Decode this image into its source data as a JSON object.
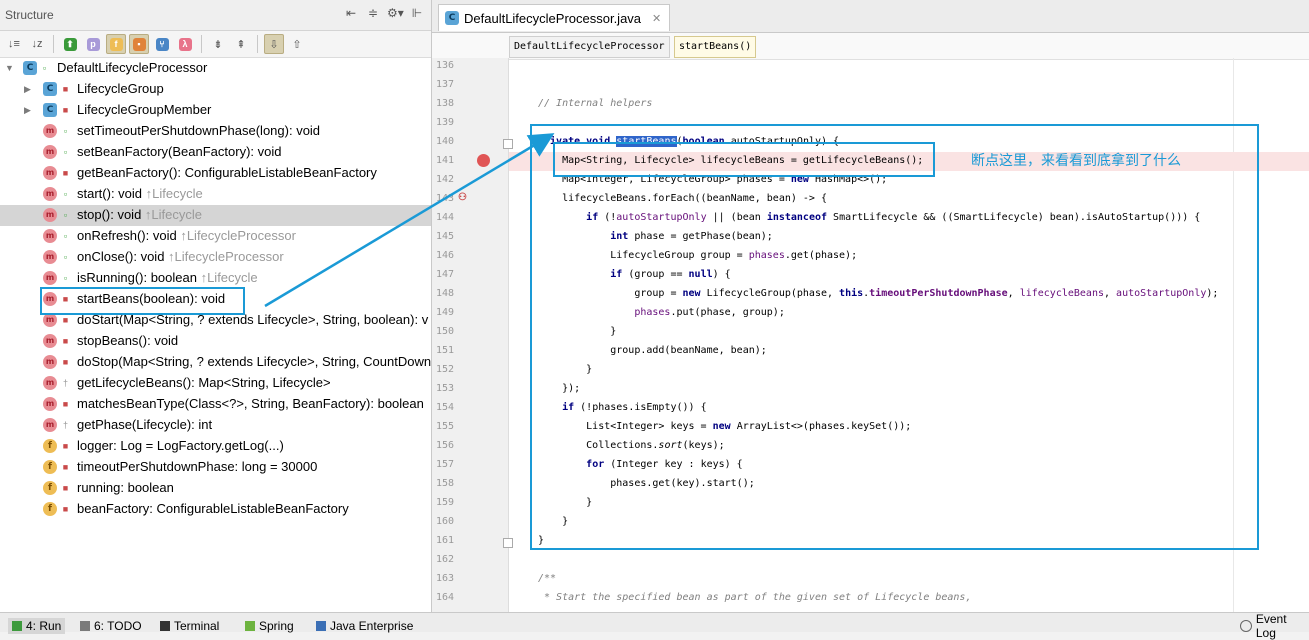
{
  "structure": {
    "title": "Structure",
    "header_tools": [
      "⇤",
      "≑",
      "⚙▾",
      "⊩"
    ],
    "toolbar_buttons": [
      {
        "name": "sort-by-visibility-icon",
        "glyph": "↓≡"
      },
      {
        "name": "sort-alpha-icon",
        "glyph": "↓z"
      },
      {
        "name": "show-inherited-icon",
        "glyph": "⬆"
      },
      {
        "name": "show-properties-icon",
        "glyph": "p"
      },
      {
        "name": "show-fields-icon",
        "glyph": "f"
      },
      {
        "name": "show-non-public-icon",
        "glyph": "▪"
      },
      {
        "name": "show-anonymous-icon",
        "glyph": "⑂"
      },
      {
        "name": "show-lambdas-icon",
        "glyph": "λ"
      },
      {
        "name": "expand-all-icon",
        "glyph": "⇟"
      },
      {
        "name": "collapse-all-icon",
        "glyph": "⇞"
      },
      {
        "name": "autoscroll-to-source-icon",
        "glyph": "⇩"
      },
      {
        "name": "autoscroll-from-source-icon",
        "glyph": "⇧"
      }
    ],
    "root": "DefaultLifecycleProcessor",
    "items": [
      {
        "icon": "c",
        "vis": "lock",
        "label": "LifecycleGroup",
        "inherited": "",
        "expandable": true
      },
      {
        "icon": "c",
        "vis": "lock",
        "label": "LifecycleGroupMember",
        "inherited": "",
        "expandable": true
      },
      {
        "icon": "m",
        "vis": "pub",
        "label": "setTimeoutPerShutdownPhase(long): void",
        "inherited": ""
      },
      {
        "icon": "m",
        "vis": "pub",
        "label": "setBeanFactory(BeanFactory): void",
        "inherited": ""
      },
      {
        "icon": "m",
        "vis": "lock",
        "label": "getBeanFactory(): ConfigurableListableBeanFactory",
        "inherited": ""
      },
      {
        "icon": "m",
        "vis": "pub",
        "label": "start(): void ",
        "inherited": "↑Lifecycle"
      },
      {
        "icon": "m",
        "vis": "pub",
        "label": "stop(): void ",
        "inherited": "↑Lifecycle",
        "selected": true
      },
      {
        "icon": "m",
        "vis": "pub",
        "label": "onRefresh(): void ",
        "inherited": "↑LifecycleProcessor"
      },
      {
        "icon": "m",
        "vis": "pub",
        "label": "onClose(): void ",
        "inherited": "↑LifecycleProcessor"
      },
      {
        "icon": "m",
        "vis": "pub",
        "label": "isRunning(): boolean ",
        "inherited": "↑Lifecycle"
      },
      {
        "icon": "m",
        "vis": "lock",
        "label": "startBeans(boolean): void",
        "inherited": ""
      },
      {
        "icon": "m",
        "vis": "lock",
        "label": "doStart(Map<String, ? extends Lifecycle>, String, boolean): v",
        "inherited": ""
      },
      {
        "icon": "m",
        "vis": "lock",
        "label": "stopBeans(): void",
        "inherited": ""
      },
      {
        "icon": "m",
        "vis": "lock",
        "label": "doStop(Map<String, ? extends Lifecycle>, String, CountDown",
        "inherited": ""
      },
      {
        "icon": "m",
        "vis": "pkg",
        "label": "getLifecycleBeans(): Map<String, Lifecycle>",
        "inherited": ""
      },
      {
        "icon": "m",
        "vis": "lock",
        "label": "matchesBeanType(Class<?>, String, BeanFactory): boolean",
        "inherited": ""
      },
      {
        "icon": "m",
        "vis": "pkg",
        "label": "getPhase(Lifecycle): int",
        "inherited": ""
      },
      {
        "icon": "f",
        "vis": "lock",
        "label": "logger: Log = LogFactory.getLog(...)",
        "inherited": ""
      },
      {
        "icon": "f",
        "vis": "lock",
        "label": "timeoutPerShutdownPhase: long = 30000",
        "inherited": ""
      },
      {
        "icon": "f",
        "vis": "lock",
        "label": "running: boolean",
        "inherited": ""
      },
      {
        "icon": "f",
        "vis": "lock",
        "label": "beanFactory: ConfigurableListableBeanFactory",
        "inherited": ""
      }
    ]
  },
  "editor": {
    "tab_label": "DefaultLifecycleProcessor.java",
    "breadcrumbs": [
      "DefaultLifecycleProcessor",
      "startBeans()"
    ],
    "annotation": "断点这里，来看看到底拿到了什么",
    "lines": [
      {
        "n": "136",
        "html": ""
      },
      {
        "n": "137",
        "html": ""
      },
      {
        "n": "138",
        "html": "<span class=\"cm\">// Internal helpers</span>"
      },
      {
        "n": "139",
        "html": ""
      },
      {
        "n": "140",
        "html": "<span class=\"kw\">private void</span> <span class=\"sel-word\">startBeans</span>(<span class=\"kw\">boolean</span> autoStartupOnly) {"
      },
      {
        "n": "141",
        "html": "    Map&lt;String, Lifecycle&gt; lifecycleBeans = getLifecycleBeans();"
      },
      {
        "n": "142",
        "html": "    Map&lt;Integer, LifecycleGroup&gt; phases = <span class=\"kw\">new</span> HashMap&lt;&gt;();"
      },
      {
        "n": "143",
        "html": "    lifecycleBeans.forEach((beanName, bean) -&gt; {"
      },
      {
        "n": "144",
        "html": "        <span class=\"kw\">if</span> (!<span class=\"fld\">autoStartupOnly</span> || (bean <span class=\"kw\">instanceof</span> SmartLifecycle &amp;&amp; ((SmartLifecycle) bean).isAutoStartup())) {"
      },
      {
        "n": "145",
        "html": "            <span class=\"kw\">int</span> phase = getPhase(bean);"
      },
      {
        "n": "146",
        "html": "            LifecycleGroup group = <span class=\"fld\">phases</span>.get(phase);"
      },
      {
        "n": "147",
        "html": "            <span class=\"kw\">if</span> (group == <span class=\"kw\">null</span>) {"
      },
      {
        "n": "148",
        "html": "                group = <span class=\"kw\">new</span> LifecycleGroup(phase, <span class=\"kw\">this</span>.<span class=\"fldb\">timeoutPerShutdownPhase</span>, <span class=\"fld\">lifecycleBeans</span>, <span class=\"fld\">autoStartupOnly</span>);"
      },
      {
        "n": "149",
        "html": "                <span class=\"fld\">phases</span>.put(phase, group);"
      },
      {
        "n": "150",
        "html": "            }"
      },
      {
        "n": "151",
        "html": "            group.add(beanName, bean);"
      },
      {
        "n": "152",
        "html": "        }"
      },
      {
        "n": "153",
        "html": "    });"
      },
      {
        "n": "154",
        "html": "    <span class=\"kw\">if</span> (!phases.isEmpty()) {"
      },
      {
        "n": "155",
        "html": "        List&lt;Integer&gt; keys = <span class=\"kw\">new</span> ArrayList&lt;&gt;(phases.keySet());"
      },
      {
        "n": "156",
        "html": "        Collections.<span class=\"it\">sort</span>(keys);"
      },
      {
        "n": "157",
        "html": "        <span class=\"kw\">for</span> (Integer key : keys) {"
      },
      {
        "n": "158",
        "html": "            phases.get(key).start();"
      },
      {
        "n": "159",
        "html": "        }"
      },
      {
        "n": "160",
        "html": "    }"
      },
      {
        "n": "161",
        "html": "}"
      },
      {
        "n": "162",
        "html": ""
      },
      {
        "n": "163",
        "html": "<span class=\"cm\">/**</span>"
      },
      {
        "n": "164",
        "html": "<span class=\"cm\"> * Start the specified bean as part of the given set of Lifecycle beans,</span>"
      }
    ]
  },
  "bottom_tabs": [
    {
      "label": "4: Run",
      "icon": "run-icon",
      "color": "#3d9a3d",
      "active": true
    },
    {
      "label": "6: TODO",
      "icon": "todo-icon",
      "color": "#7a7a7a"
    },
    {
      "label": "Terminal",
      "icon": "terminal-icon",
      "color": "#333333"
    },
    {
      "label": "Spring",
      "icon": "spring-icon",
      "color": "#6db33f"
    },
    {
      "label": "Java Enterprise",
      "icon": "java-enterprise-icon",
      "color": "#3b6fb5"
    }
  ],
  "event_log": "Event Log",
  "colors": {
    "accent": "#1a9ad6",
    "breakpoint": "#e05555",
    "selection": "#2f65ca"
  }
}
